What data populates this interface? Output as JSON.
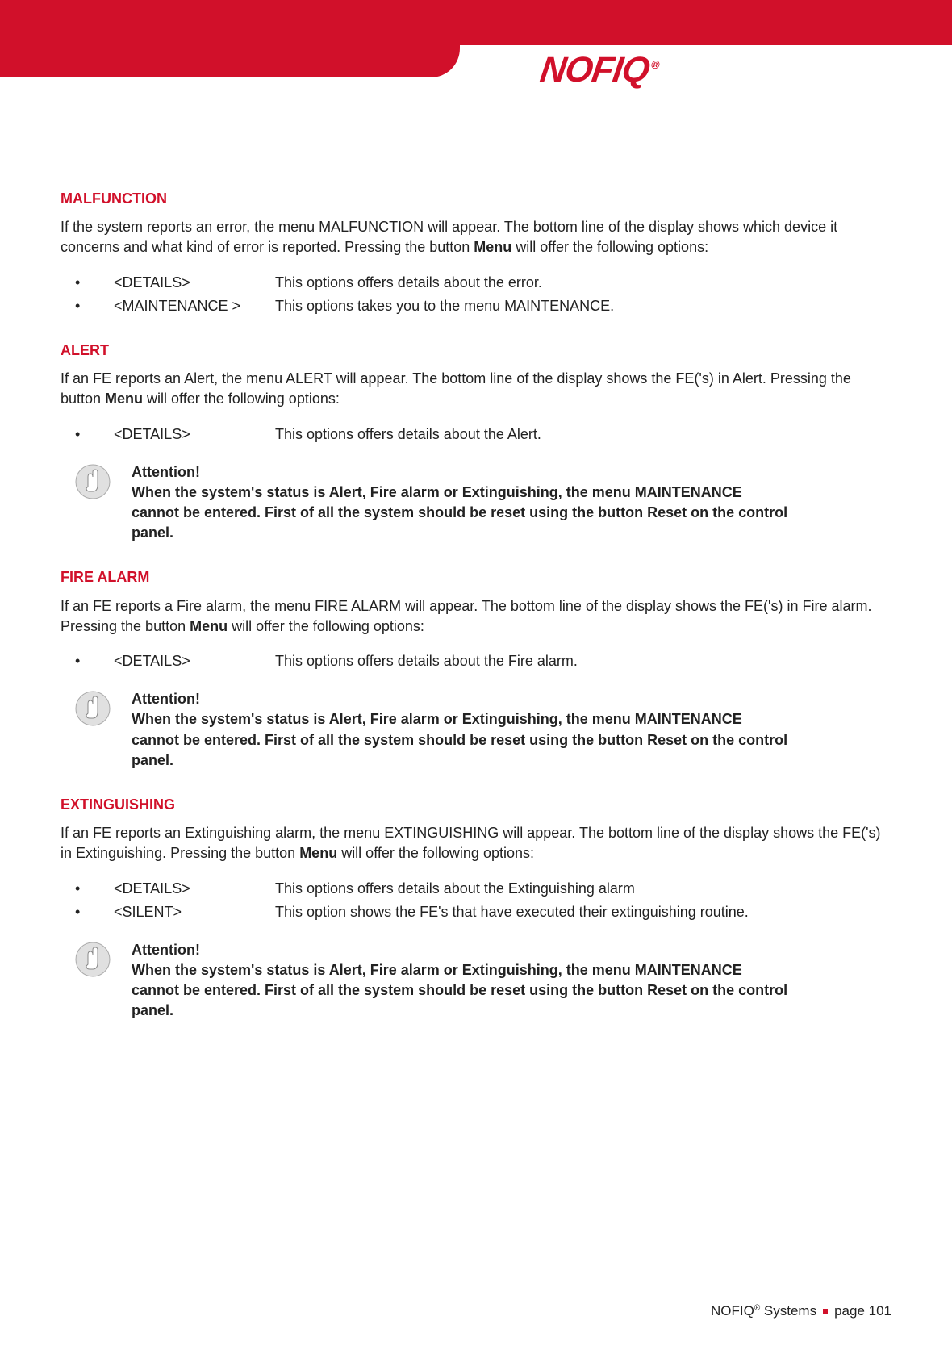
{
  "brand": {
    "logo_text": "NOFIQ",
    "reg": "®"
  },
  "sections": {
    "malfunction": {
      "heading": "MALFUNCTION",
      "intro_a": "If the system reports an error, the menu MALFUNCTION will appear. The bottom line of the display shows which device it concerns and what kind of error is reported. Pressing the button ",
      "intro_b": "Menu",
      "intro_c": " will offer the following options:",
      "opts": [
        {
          "key": "<DETAILS>",
          "desc": "This options offers details about the error."
        },
        {
          "key": "<MAINTENANCE >",
          "desc": "This options takes you to the menu MAINTENANCE."
        }
      ]
    },
    "alert": {
      "heading": "ALERT",
      "intro_a": "If an FE reports an Alert, the menu ALERT will appear.  The bottom line of the display shows the FE('s) in Alert. Pressing the button ",
      "intro_b": "Menu",
      "intro_c": " will offer the following options:",
      "opts": [
        {
          "key": "<DETAILS>",
          "desc": "This options offers details about the Alert."
        }
      ]
    },
    "firealarm": {
      "heading": "FIRE ALARM",
      "intro_a": "If an FE reports a Fire alarm, the menu FIRE ALARM will appear.  The bottom line of the display shows the FE('s) in Fire alarm. Pressing the button ",
      "intro_b": "Menu",
      "intro_c": " will offer the following options:",
      "opts": [
        {
          "key": "<DETAILS>",
          "desc": "This options offers details about the Fire alarm."
        }
      ]
    },
    "extinguishing": {
      "heading": "EXTINGUISHING",
      "intro_a": "If an FE reports an Extinguishing alarm, the menu EXTINGUISHING will appear.  The bottom line of the display shows the FE('s) in Extinguishing. Pressing the button ",
      "intro_b": "Menu",
      "intro_c": " will offer the following options:",
      "opts": [
        {
          "key": "<DETAILS>",
          "desc": "This options offers details about the Extinguishing alarm"
        },
        {
          "key": "<SILENT>",
          "desc": "This option shows the FE's that have executed their extinguishing routine."
        }
      ]
    }
  },
  "attention": {
    "title": "Attention!",
    "body": "When the system's status is Alert, Fire alarm or Extinguishing, the menu MAINTENANCE cannot be entered. First of all the system should be reset using the button Reset on the control panel."
  },
  "footer": {
    "brand": "NOFIQ",
    "reg": "®",
    "systems": " Systems",
    "page": "page 101"
  }
}
